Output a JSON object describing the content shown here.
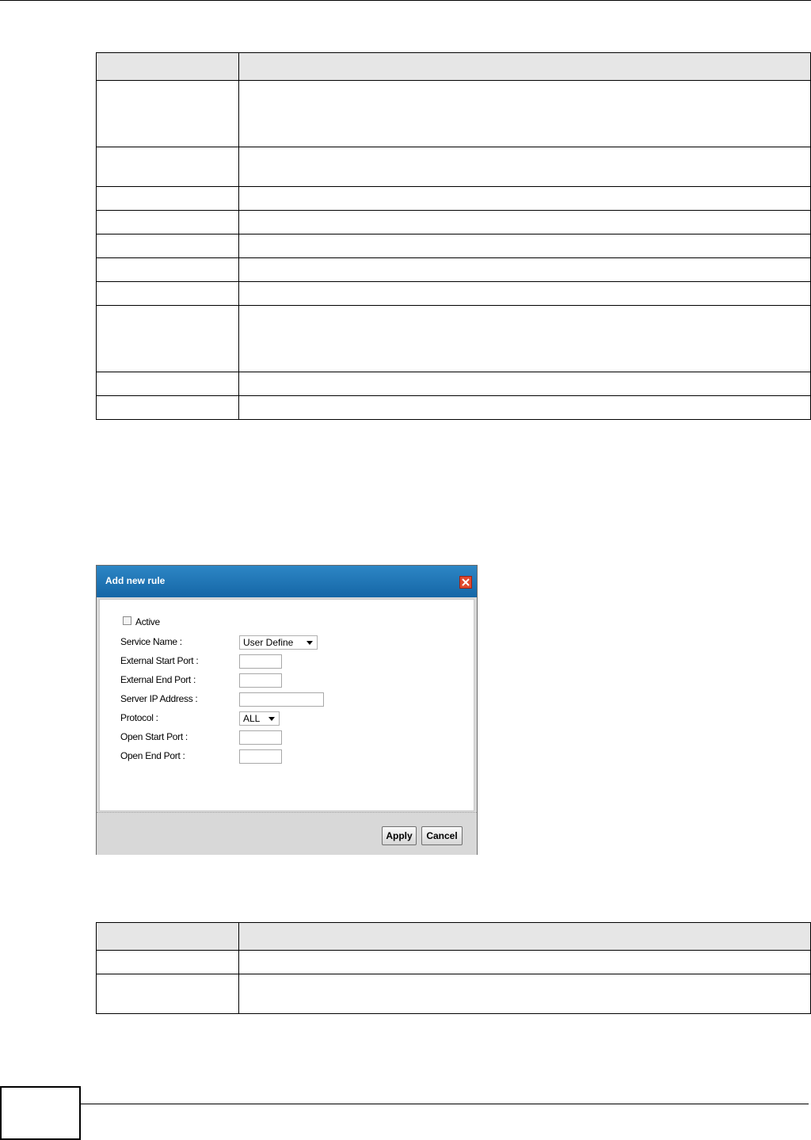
{
  "dialog": {
    "title": "Add new rule",
    "active_label": "Active",
    "active_checked": false,
    "fields": {
      "service_name": {
        "label": "Service Name :",
        "value": "User Define"
      },
      "external_start_port": {
        "label": "External Start Port :",
        "value": ""
      },
      "external_end_port": {
        "label": "External End Port :",
        "value": ""
      },
      "server_ip_address": {
        "label": "Server IP Address :",
        "value": ""
      },
      "protocol": {
        "label": "Protocol :",
        "value": "ALL"
      },
      "open_start_port": {
        "label": "Open Start Port :",
        "value": ""
      },
      "open_end_port": {
        "label": "Open End Port :",
        "value": ""
      }
    },
    "apply_label": "Apply",
    "cancel_label": "Cancel"
  }
}
